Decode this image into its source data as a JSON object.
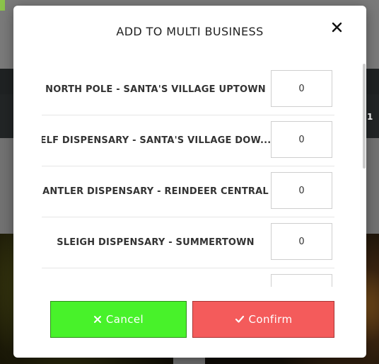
{
  "modal": {
    "title": "ADD TO MULTI BUSINESS",
    "close_icon": "close-icon",
    "businesses": [
      {
        "name": "NORTH POLE - SANTA'S VILLAGE UPTOWN",
        "quantity": "0"
      },
      {
        "name": "ELF DISPENSARY - SANTA'S VILLAGE DOW...",
        "quantity": "0"
      },
      {
        "name": "ANTLER DISPENSARY - REINDEER CENTRAL",
        "quantity": "0"
      },
      {
        "name": "SLEIGH DISPENSARY - SUMMERTOWN",
        "quantity": "0"
      },
      {
        "name": "",
        "quantity": ""
      }
    ],
    "cancel_label": "Cancel",
    "cancel_icon": "x-icon",
    "confirm_label": "Confirm",
    "confirm_icon": "check-icon"
  },
  "background": {
    "row_number": "1"
  },
  "colors": {
    "cancel_bg": "#48f22a",
    "confirm_bg": "#f45b5b"
  }
}
